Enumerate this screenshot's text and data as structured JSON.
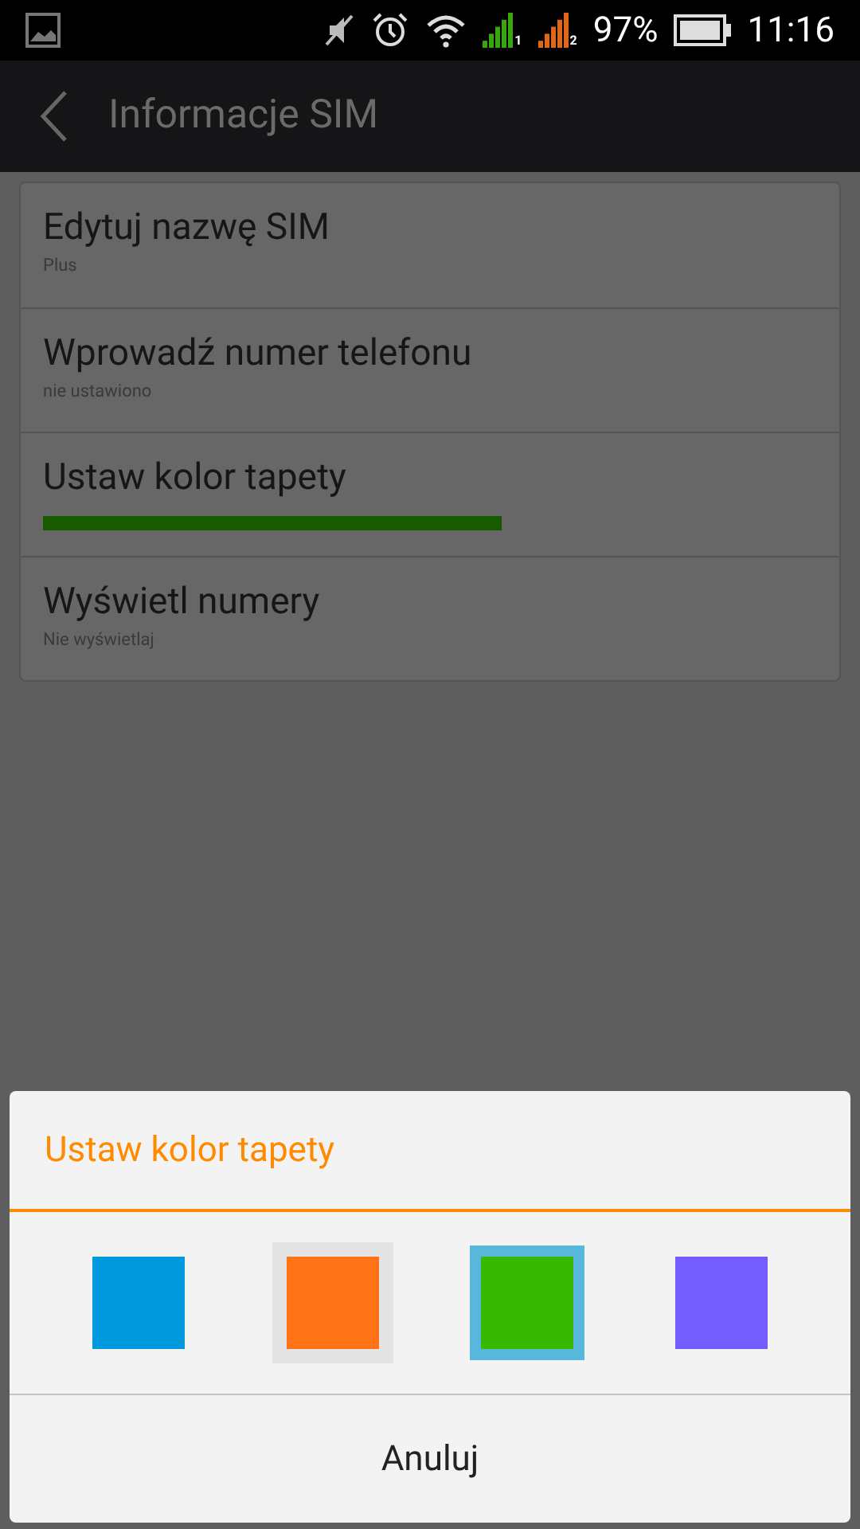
{
  "status_bar": {
    "battery": "97%",
    "time": "11:16",
    "signals": [
      {
        "label": "1",
        "color": "#3aa60f"
      },
      {
        "label": "2",
        "color": "#e0661a"
      }
    ]
  },
  "app_bar": {
    "title": "Informacje SIM"
  },
  "settings": [
    {
      "kind": "text",
      "title": "Edytuj nazwę SIM",
      "subtitle": "Plus"
    },
    {
      "kind": "text",
      "title": "Wprowadź numer telefonu",
      "subtitle": "nie ustawiono"
    },
    {
      "kind": "color",
      "title": "Ustaw kolor tapety",
      "color": "#175a00"
    },
    {
      "kind": "text",
      "title": "Wyświetl numery",
      "subtitle": "Nie wyświetlaj"
    }
  ],
  "dialog": {
    "title": "Ustaw kolor tapety",
    "swatches": [
      {
        "color": "#0099dd",
        "selected": false,
        "focused": false
      },
      {
        "color": "#ff7316",
        "selected": false,
        "focused": true
      },
      {
        "color": "#36b900",
        "selected": true,
        "focused": false
      },
      {
        "color": "#745dff",
        "selected": false,
        "focused": false
      }
    ],
    "button": "Anuluj"
  }
}
